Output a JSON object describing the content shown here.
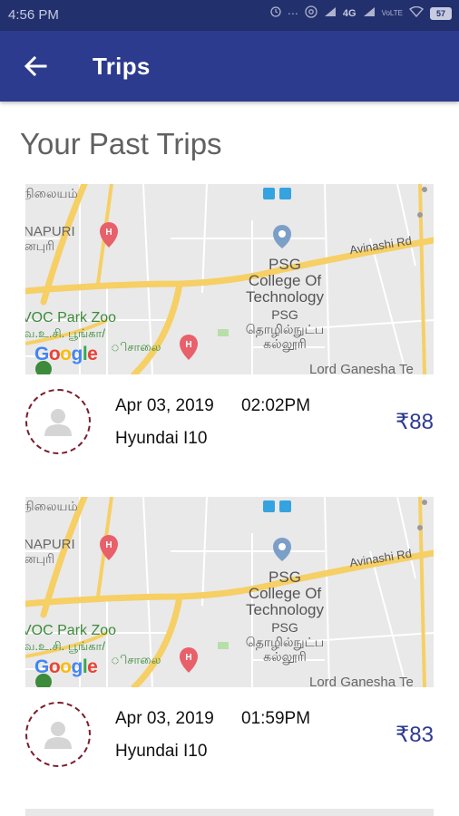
{
  "status_bar": {
    "time": "4:56 PM",
    "network": "4G",
    "battery": "57",
    "icons": [
      "alarm-icon",
      "data-arrows-icon",
      "signal-icon",
      "volte-icon",
      "wifi-icon",
      "battery-icon"
    ]
  },
  "app_bar": {
    "title": "Trips",
    "back_icon": "arrow-left-icon"
  },
  "section_heading": "Your Past Trips",
  "map": {
    "area_top": "நிலையம்",
    "area_left": "NAPURI",
    "area_left_tamil": "னபுரி",
    "road": "Avinashi Rd",
    "college_en": [
      "PSG",
      "College Of",
      "Technology"
    ],
    "college_ta": [
      "PSG",
      "தொழில்நுட்ப",
      "கல்லூரி"
    ],
    "zoo": "VOC Park Zoo",
    "zoo_ta": "வ.உ.சி. பூங்கா/",
    "zoo_ta2": "ிசாலை",
    "temple": "Lord Ganesha Te",
    "logo": [
      "G",
      "o",
      "o",
      "g",
      "l",
      "e"
    ]
  },
  "trips": [
    {
      "date": "Apr 03, 2019",
      "time": "02:02PM",
      "car": "Hyundai I10",
      "fare": "₹88"
    },
    {
      "date": "Apr 03, 2019",
      "time": "01:59PM",
      "car": "Hyundai I10",
      "fare": "₹83"
    }
  ],
  "colors": {
    "app_bar": "#2d3b8e",
    "status_bar": "#23306e",
    "fare": "#2d3b8e",
    "avatar_border": "#7b1d2b"
  }
}
